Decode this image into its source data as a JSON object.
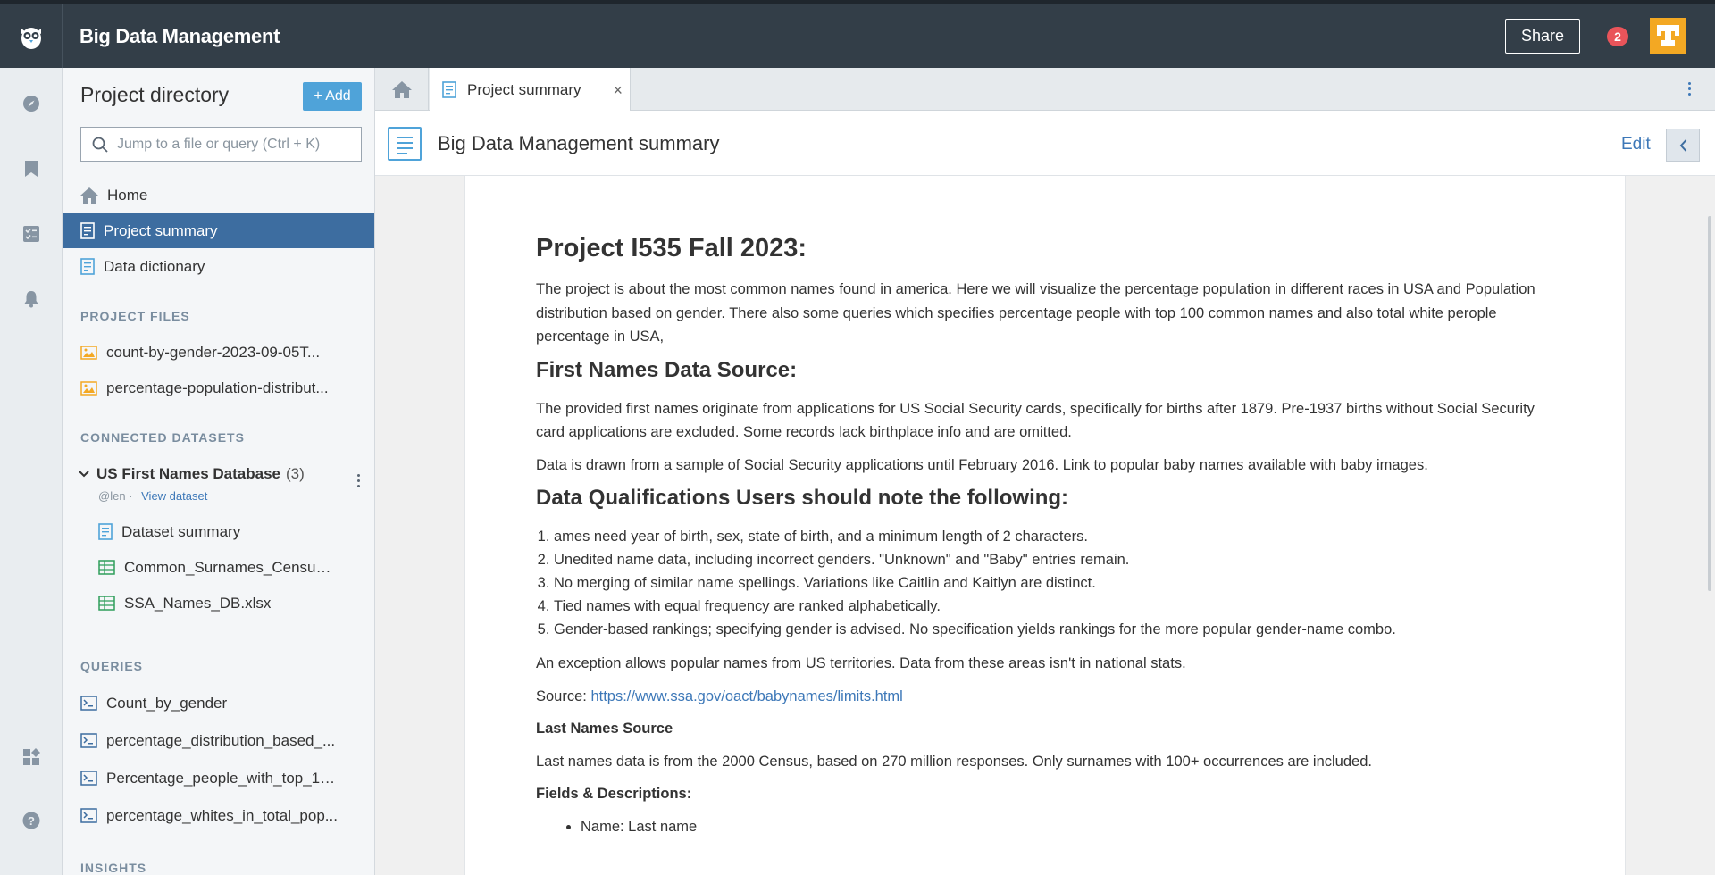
{
  "app": {
    "title": "Big Data Management"
  },
  "topbar": {
    "share_label": "Share",
    "notification_count": "2"
  },
  "sidebar": {
    "title": "Project directory",
    "add_label": "+ Add",
    "search_placeholder": "Jump to a file or query (Ctrl + K)",
    "nav": [
      {
        "label": "Home"
      },
      {
        "label": "Project summary"
      },
      {
        "label": "Data dictionary"
      }
    ],
    "project_files_heading": "PROJECT FILES",
    "project_files": [
      {
        "label": "count-by-gender-2023-09-05T..."
      },
      {
        "label": "percentage-population-distribut..."
      }
    ],
    "connected_heading": "CONNECTED DATASETS",
    "dataset": {
      "name": "US First Names Database",
      "count": "(3)",
      "owner": "@len ·",
      "view_label": "View dataset",
      "files": [
        {
          "label": "Dataset summary"
        },
        {
          "label": "Common_Surnames_Census_..."
        },
        {
          "label": "SSA_Names_DB.xlsx"
        }
      ]
    },
    "queries_heading": "QUERIES",
    "queries": [
      {
        "label": "Count_by_gender"
      },
      {
        "label": "percentage_distribution_based_..."
      },
      {
        "label": "Percentage_people_with_top_10..."
      },
      {
        "label": "percentage_whites_in_total_pop..."
      }
    ],
    "insights_heading": "INSIGHTS"
  },
  "tabs": {
    "active_label": "Project summary",
    "close_glyph": "×"
  },
  "doc": {
    "header_title": "Big Data Management summary",
    "edit_label": "Edit",
    "h1": "Project I535 Fall 2023:",
    "intro": "The project is about the most common names found in america. Here we will visualize the percentage population in different races in USA and Population distribution based on gender. There also some queries which specifies percentage people with top 100 common names and also total white perople percentage in USA,",
    "h2_source": "First Names Data Source:",
    "source_p1": "The provided first names originate from applications for US Social Security cards, specifically for births after 1879. Pre-1937 births without Social Security card applications are excluded. Some records lack birthplace info and are omitted.",
    "source_p2": "Data is drawn from a sample of Social Security applications until February 2016. Link to popular baby names available with baby images.",
    "h2_qual": "Data Qualifications Users should note the following:",
    "qualifications": [
      "ames need year of birth, sex, state of birth, and a minimum length of 2 characters.",
      "Unedited name data, including incorrect genders. \"Unknown\" and \"Baby\" entries remain.",
      "No merging of similar name spellings. Variations like Caitlin and Kaitlyn are distinct.",
      "Tied names with equal frequency are ranked alphabetically.",
      "Gender-based rankings; specifying gender is advised. No specification yields rankings for the more popular gender-name combo."
    ],
    "exception": "An exception allows popular names from US territories. Data from these areas isn't in national stats.",
    "source_prefix": "Source: ",
    "source_url": "https://www.ssa.gov/oact/babynames/limits.html",
    "last_names_heading": "Last Names Source",
    "last_names_p": "Last names data is from the 2000 Census, based on 270 million responses. Only surnames with 100+ occurrences are included.",
    "fields_heading": "Fields & Descriptions:",
    "fields": [
      "Name: Last name"
    ]
  },
  "colors": {
    "topbar": "#333e48",
    "active": "#3d6da0",
    "accent": "#4fa3d9",
    "link": "#3d78b8",
    "avatar": "#f3a823",
    "badge": "#e9545a"
  }
}
